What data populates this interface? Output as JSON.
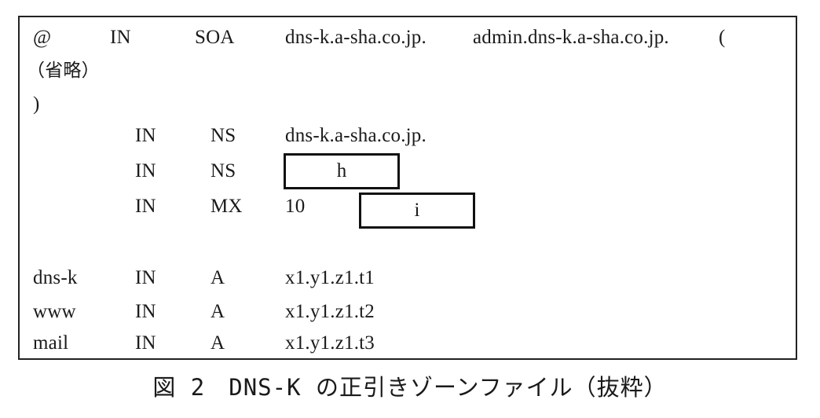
{
  "zone_file": {
    "soa": {
      "name": "@",
      "class": "IN",
      "type": "SOA",
      "primary_ns": "dns-k.a-sha.co.jp.",
      "admin": "admin.dns-k.a-sha.co.jp.",
      "open_paren": "(",
      "omitted": "（省略）",
      "close_paren": ")"
    },
    "records": [
      {
        "name": "",
        "class": "IN",
        "type": "NS",
        "value": "dns-k.a-sha.co.jp."
      },
      {
        "name": "",
        "class": "IN",
        "type": "NS",
        "blank": "h"
      },
      {
        "name": "",
        "class": "IN",
        "type": "MX",
        "priority": "10",
        "blank": "i"
      },
      {
        "name": "dns-k",
        "class": "IN",
        "type": "A",
        "value": "x1.y1.z1.t1"
      },
      {
        "name": "www",
        "class": "IN",
        "type": "A",
        "value": "x1.y1.z1.t2"
      },
      {
        "name": "mail",
        "class": "IN",
        "type": "A",
        "value": "x1.y1.z1.t3"
      }
    ]
  },
  "caption": "図 2　DNS-K の正引きゾーンファイル（抜粋）"
}
